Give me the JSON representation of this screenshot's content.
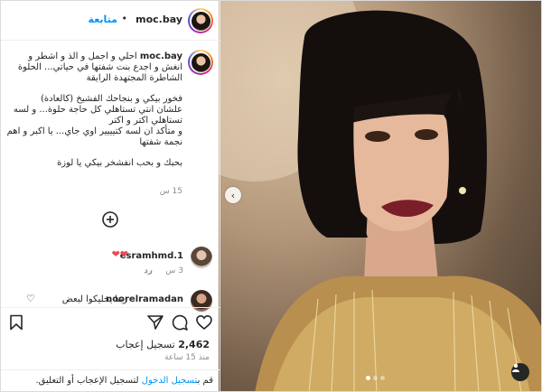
{
  "header": {
    "username": "moc.bay",
    "separator": "•",
    "follow_label": "متابعة"
  },
  "caption": {
    "username": "moc.bay",
    "first_line": " احلي و اجمل و الذ و اشطر و انغش و اجدع بنت شفتها في حياتي... الحلوة الشاطرة المجتهدة الرايقة",
    "paragraph2": "فخور بيكي و بنجاحك الفشيخ (كالعادة)\nعلشان انتي تستاهلي كل حاجة حلوة... و لسه تستاهلي اكتر و اكتر\nو متأكد ان لسه كتيييير اوي جاي... يا اكبر و اهم نجمة شفتها",
    "paragraph3": "بحبك و بحب انفشخر بيكي يا لوزة",
    "time": "15 س"
  },
  "comments": [
    {
      "username": "esramhmd.1",
      "text": "",
      "hearts": "❤❤",
      "time": "3 س",
      "reply_label": "رد"
    },
    {
      "username": "noorelramadan",
      "text": "ربنا يخليكوا لبعض",
      "hearts": "",
      "time": "",
      "reply_label": ""
    }
  ],
  "icons": {
    "add": "add-comments-icon",
    "like": "heart-icon",
    "comment": "comment-icon",
    "share": "share-icon",
    "save": "bookmark-icon",
    "carousel_prev": "chevron-left-icon",
    "tag": "user-tag-icon",
    "comment_heart": "heart-outline-icon"
  },
  "likes": {
    "count": "2,462",
    "label": "تسجيل إعجاب"
  },
  "posted_ago": "منذ 15 ساعة",
  "footer": {
    "login_label": "تسجيل الدخول",
    "prefix": "قم ب",
    "suffix": " لتسجيل الإعجاب أو التعليق."
  },
  "carousel": {
    "current": 1,
    "total": 3
  },
  "colors": {
    "accent": "#0095f6",
    "heart": "#ed4956",
    "muted": "#8e8e8e"
  }
}
